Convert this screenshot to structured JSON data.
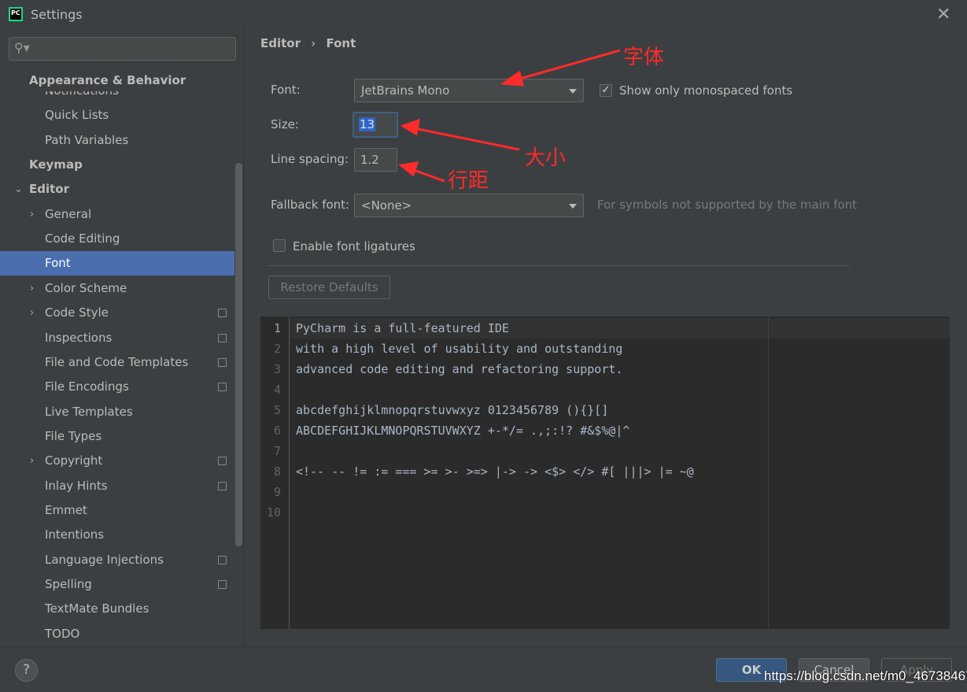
{
  "window": {
    "title": "Settings",
    "app_icon": "PC"
  },
  "search": {
    "placeholder": ""
  },
  "sidebar": {
    "sticky_header": "Appearance & Behavior",
    "items": [
      {
        "label": "Notifications",
        "level": 1
      },
      {
        "label": "Quick Lists",
        "level": 1
      },
      {
        "label": "Path Variables",
        "level": 1
      },
      {
        "label": "Keymap",
        "level": 0
      },
      {
        "label": "Editor",
        "level": 0,
        "expanded": true
      },
      {
        "label": "General",
        "level": 1,
        "chevron": true
      },
      {
        "label": "Code Editing",
        "level": 1
      },
      {
        "label": "Font",
        "level": 1,
        "selected": true
      },
      {
        "label": "Color Scheme",
        "level": 1,
        "chevron": true
      },
      {
        "label": "Code Style",
        "level": 1,
        "chevron": true,
        "badge": true
      },
      {
        "label": "Inspections",
        "level": 1,
        "badge": true
      },
      {
        "label": "File and Code Templates",
        "level": 1,
        "badge": true
      },
      {
        "label": "File Encodings",
        "level": 1,
        "badge": true
      },
      {
        "label": "Live Templates",
        "level": 1
      },
      {
        "label": "File Types",
        "level": 1
      },
      {
        "label": "Copyright",
        "level": 1,
        "chevron": true,
        "badge": true
      },
      {
        "label": "Inlay Hints",
        "level": 1,
        "badge": true
      },
      {
        "label": "Emmet",
        "level": 1
      },
      {
        "label": "Intentions",
        "level": 1
      },
      {
        "label": "Language Injections",
        "level": 1,
        "badge": true
      },
      {
        "label": "Spelling",
        "level": 1,
        "badge": true
      },
      {
        "label": "TextMate Bundles",
        "level": 1
      },
      {
        "label": "TODO",
        "level": 1
      }
    ]
  },
  "breadcrumb": {
    "parent": "Editor",
    "separator": "›",
    "current": "Font"
  },
  "form": {
    "font_label": "Font:",
    "font_value": "JetBrains Mono",
    "mono_label": "Show only monospaced fonts",
    "mono_checked": true,
    "size_label": "Size:",
    "size_value": "13",
    "spacing_label": "Line spacing:",
    "spacing_value": "1.2",
    "fallback_label": "Fallback font:",
    "fallback_value": "<None>",
    "fallback_hint": "For symbols not supported by the main font",
    "ligatures_label": "Enable font ligatures",
    "ligatures_checked": false,
    "restore_label": "Restore Defaults"
  },
  "preview": {
    "lines": [
      "PyCharm is a full-featured IDE",
      "with a high level of usability and outstanding",
      "advanced code editing and refactoring support.",
      "",
      "abcdefghijklmnopqrstuvwxyz 0123456789 (){}[]",
      "ABCDEFGHIJKLMNOPQRSTUVWXYZ +-*/= .,;:!? #&$%@|^",
      "",
      "<!-- -- != := === >= >- >=> |-> -> <$> </> #[ |||> |= ~@",
      "",
      ""
    ]
  },
  "annotations": {
    "font": "字体",
    "size": "大小",
    "spacing": "行距",
    "color": "#ff2a2a"
  },
  "footer": {
    "help": "?",
    "ok": "OK",
    "cancel": "Cancel",
    "apply": "Apply"
  },
  "watermark": "https://blog.csdn.net/m0_46738467",
  "colors": {
    "selection": "#4b6eaf",
    "editor_bg": "#2b2b2b",
    "panel_bg": "#3c3f41"
  }
}
